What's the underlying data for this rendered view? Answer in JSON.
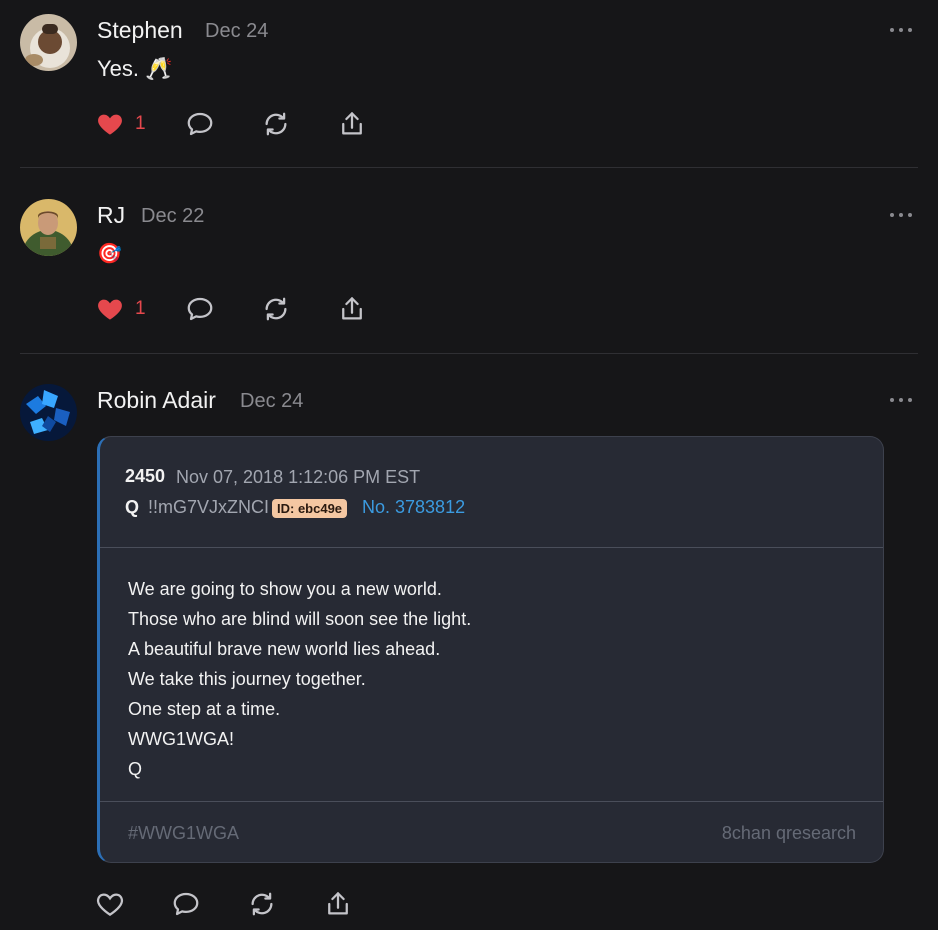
{
  "posts": [
    {
      "author": "Stephen",
      "date": "Dec 24",
      "text": "Yes. 🥂",
      "likes": "1",
      "liked": true
    },
    {
      "author": "RJ",
      "date": "Dec 22",
      "text": "🎯",
      "likes": "1",
      "liked": true
    },
    {
      "author": "Robin Adair",
      "date": "Dec 24",
      "liked": false,
      "embed": {
        "number": "2450",
        "datetime": "Nov 07, 2018 1:12:06 PM EST",
        "author": "Q",
        "tripcode": "!!mG7VJxZNCI",
        "id_badge": "ID: ebc49e",
        "post_no": "No. 3783812",
        "lines": [
          "We are going to show you a new world.",
          "Those who are blind will soon see the light.",
          "A beautiful brave new world lies ahead.",
          "We take this journey together.",
          "One step at a time.",
          "WWG1WGA!",
          "Q"
        ],
        "hashtag": "#WWG1WGA",
        "source": "8chan qresearch"
      }
    }
  ],
  "colors": {
    "background": "#161618",
    "like": "#e5484d",
    "link": "#3b9be0",
    "card_accent": "#2c6fb6",
    "id_badge": "#f4c7a2"
  },
  "icons": [
    "heart-icon",
    "reply-icon",
    "repost-icon",
    "share-icon",
    "more-icon"
  ]
}
